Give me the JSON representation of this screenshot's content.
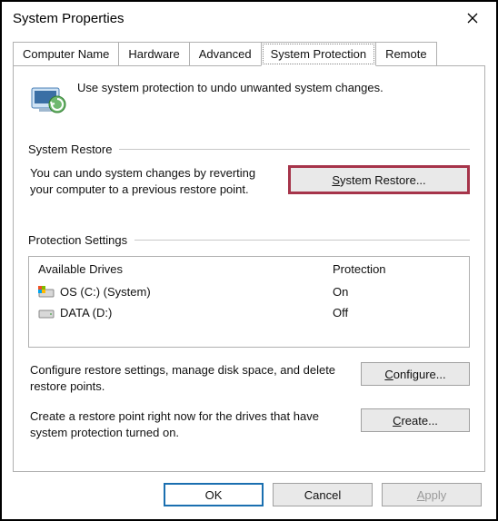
{
  "window": {
    "title": "System Properties"
  },
  "tabs": {
    "computer_name": "Computer Name",
    "hardware": "Hardware",
    "advanced": "Advanced",
    "system_protection": "System Protection",
    "remote": "Remote"
  },
  "intro": {
    "text": "Use system protection to undo unwanted system changes."
  },
  "restore": {
    "heading": "System Restore",
    "text": "You can undo system changes by reverting your computer to a previous restore point.",
    "button_prefix": "S",
    "button_rest": "ystem Restore..."
  },
  "protection": {
    "heading": "Protection Settings",
    "col_drive": "Available Drives",
    "col_prot": "Protection",
    "rows": [
      {
        "name": "OS (C:) (System)",
        "status": "On"
      },
      {
        "name": "DATA (D:)",
        "status": "Off"
      }
    ],
    "configure_text": "Configure restore settings, manage disk space, and delete restore points.",
    "configure_u": "C",
    "configure_rest": "onfigure...",
    "create_text": "Create a restore point right now for the drives that have system protection turned on.",
    "create_u": "C",
    "create_rest": "reate..."
  },
  "footer": {
    "ok": "OK",
    "cancel": "Cancel",
    "apply_u": "A",
    "apply_rest": "pply"
  }
}
